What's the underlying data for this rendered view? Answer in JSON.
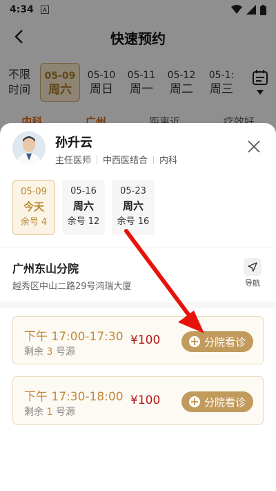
{
  "status_bar": {
    "time": "4:34",
    "notif": "A"
  },
  "nav": {
    "title": "快速预约"
  },
  "date_strip": {
    "all_line1": "不限",
    "all_line2": "时间",
    "dates": [
      {
        "date": "05-09",
        "week": "周六",
        "active": true
      },
      {
        "date": "05-10",
        "week": "周日"
      },
      {
        "date": "05-11",
        "week": "周一"
      },
      {
        "date": "05-12",
        "week": "周二"
      },
      {
        "date": "05-1:",
        "week": "周三"
      }
    ]
  },
  "filters": [
    "内科",
    "广州",
    "距离近",
    "疗效好"
  ],
  "doctor": {
    "name": "孙升云",
    "title": "主任医师",
    "type": "中西医结合",
    "dept": "内科"
  },
  "day_cards": [
    {
      "date": "05-09",
      "week": "今天",
      "remain": "余号 4",
      "active": true
    },
    {
      "date": "05-16",
      "week": "周六",
      "remain": "余号 12"
    },
    {
      "date": "05-23",
      "week": "周六",
      "remain": "余号 16"
    }
  ],
  "branch": {
    "name": "广州东山分院",
    "address": "越秀区中山二路29号鸿瑞大厦",
    "nav_label": "导航"
  },
  "slots": [
    {
      "time": "下午 17:00-17:30",
      "remain_prefix": "剩余 ",
      "remain_num": "3",
      "remain_suffix": " 号源",
      "price": "¥100",
      "button": "分院看诊"
    },
    {
      "time": "下午 17:30-18:00",
      "remain_prefix": "剩余 ",
      "remain_num": "1",
      "remain_suffix": " 号源",
      "price": "¥100",
      "button": "分院看诊"
    }
  ],
  "colors": {
    "accent": "#c29a5c",
    "price": "#b21b1b",
    "annotation_arrow": "#e8120c"
  }
}
